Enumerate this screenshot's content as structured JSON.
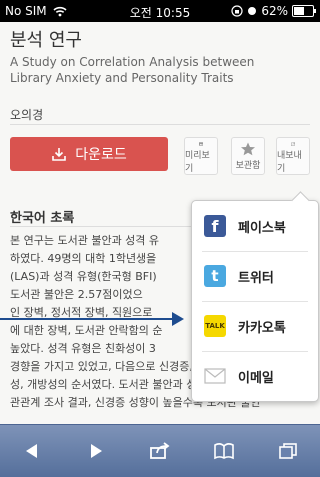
{
  "status_bar": {
    "carrier": "No SIM",
    "time": "오전 10:55",
    "battery_percent": "62%",
    "battery_level": 0.62
  },
  "article": {
    "title": "분석 연구",
    "subtitle": "A Study on Correlation Analysis between Library Anxiety and Personality Traits",
    "author": "오의경"
  },
  "actions": {
    "download_label": "다운로드",
    "preview_label": "미리보기",
    "save_label": "보관함",
    "export_label": "내보내기"
  },
  "abstract": {
    "heading": "한국어 초록",
    "lines": [
      "본 연구는 도서관 불안과 성격 유",
      "하였다. 49명의 대학 1학년생을",
      "(LAS)과 성격 유형(한국형 BFI)",
      "도서관 불안은 2.57점이었으",
      "인 장벽, 정서적 장벽, 직원으로",
      "에 대한 장벽, 도서관 안락함의 순",
      "높았다. 성격 유형은 친화성이 3",
      "경향을 가지고 있었고, 다음으로 신경증, 외향성, 성실",
      "성, 개방성의 순서였다. 도서관 불안과 성격 유형의 상",
      "관관계 조사 결과, 신경증 성향이 높을수록 도서관 불안"
    ]
  },
  "share_menu": {
    "items": [
      {
        "label": "페이스북",
        "icon": "facebook-icon"
      },
      {
        "label": "트위터",
        "icon": "twitter-icon"
      },
      {
        "label": "카카오톡",
        "icon": "kakaotalk-icon",
        "icon_text": "TALK"
      },
      {
        "label": "이메일",
        "icon": "email-icon"
      }
    ]
  },
  "toolbar": {
    "items": [
      "back-icon",
      "forward-icon",
      "share-icon",
      "bookmarks-icon",
      "tabs-icon"
    ]
  },
  "colors": {
    "download_button": "#d9534f",
    "toolbar": "#6a82ad",
    "arrow": "#1e4c8f"
  }
}
